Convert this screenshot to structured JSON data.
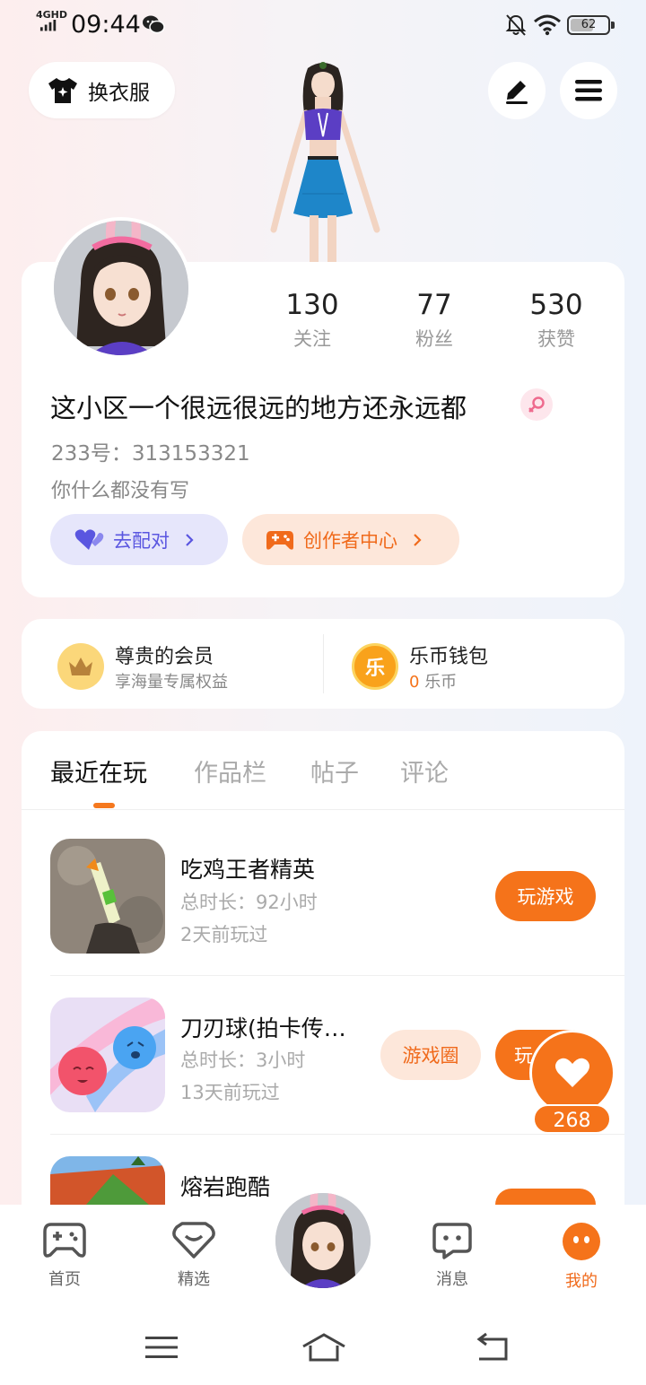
{
  "status_bar": {
    "network": "4GHD",
    "time": "09:44",
    "battery": "62",
    "battery_level": 0.62
  },
  "header": {
    "outfit_label": "换衣服",
    "outfit_icon": "tshirt-sparkle-icon",
    "edit_icon": "edit-pen-icon",
    "menu_icon": "hamburger-menu-icon"
  },
  "profile": {
    "stats": [
      {
        "value": "130",
        "label": "关注"
      },
      {
        "value": "77",
        "label": "粉丝"
      },
      {
        "value": "530",
        "label": "获赞"
      }
    ],
    "nickname": "这小区一个很远很远的地方还永远都",
    "gender_icon": "female-symbol-icon",
    "uid": "233号：313153321",
    "bio": "你什么都没有写",
    "pair_label": "去配对",
    "creator_label": "创作者中心"
  },
  "member": {
    "title": "尊贵的会员",
    "subtitle": "享海量专属权益"
  },
  "wallet": {
    "title": "乐币钱包",
    "icon_char": "乐",
    "amount": "0",
    "unit": "乐币"
  },
  "tabs": [
    "最近在玩",
    "作品栏",
    "帖子",
    "评论"
  ],
  "games": [
    {
      "name": "吃鸡王者精英",
      "duration": "总时长：92小时",
      "last_played": "2天前玩过",
      "play_label": "玩游戏"
    },
    {
      "name": "刀刃球(拍卡传…",
      "duration": "总时长：3小时",
      "last_played": "13天前玩过",
      "circle_label": "游戏圈",
      "play_label": "玩"
    },
    {
      "name": "熔岩跑酷"
    }
  ],
  "like": {
    "count": "268"
  },
  "bottom_nav": [
    {
      "label": "首页",
      "icon": "gamepad-icon"
    },
    {
      "label": "精选",
      "icon": "heart-diamond-icon"
    },
    {
      "label": "消息",
      "icon": "chat-bubble-icon"
    },
    {
      "label": "我的",
      "icon": "profile-face-icon"
    }
  ],
  "colors": {
    "accent": "#f5731a",
    "pair_purple": "#5a56e0",
    "text_gray": "#888888"
  }
}
